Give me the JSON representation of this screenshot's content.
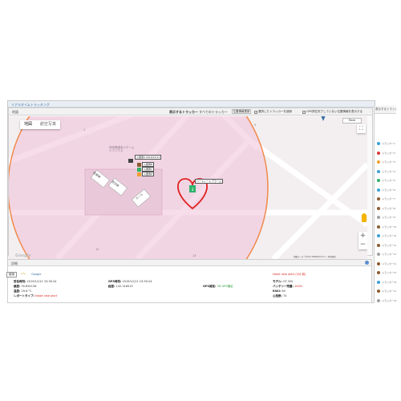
{
  "app": {
    "title": "リアルタイムトラッキング"
  },
  "map_panel": {
    "label": "地図",
    "tracker_label": "表示するトラッカー",
    "tracker_value": "すべてのトラッカー",
    "search_button": "位置情報更新",
    "check_selected": "選択したトラッカーを追跡",
    "check_gps": "GPS測位完了していない位置情報を表示する",
    "map_tabs": [
      "地図",
      "航空写真"
    ],
    "more_button": "More",
    "zoom_in": "+",
    "zoom_out": "−",
    "google": "Google",
    "footer": "地図データ ©2019 ZENRIN  20 m ─  利用規約"
  },
  "map_labels": {
    "tracker_callout": "ハートレート アラーム",
    "building_1": "特別養護老人ホーム",
    "building_2": "ケアハウス",
    "area_a": "医療棟",
    "area_b": "居住棟",
    "area_c": "ホール",
    "number_1": "1",
    "number_5": "5",
    "number_12": "12",
    "number_13": "13"
  },
  "callouts": [
    "ハートレート アラーム",
    "入居者A 2019/12/11",
    "入居者B",
    "入居者C",
    "入居者D"
  ],
  "details": {
    "header": "詳細",
    "use_button": "使用",
    "google_label": "Google",
    "alert_top": "Heart rate alert (2分 前)",
    "received_label": "受信時刻:",
    "received_value": "2019/12/11 15:30:24",
    "gps_time_label": "GPS時刻:",
    "gps_time_value": "2019/12/11 15:30:24",
    "model_label": "モデル:",
    "model_value": "GT-320",
    "lat_label": "緯度:",
    "lat_value": "35.692136",
    "lng_label": "経度:",
    "lng_value": "142.316515",
    "gps_status_label": "GPS補足:",
    "gps_status_value": "3D GPS補足",
    "battery_label": "バッテリー残量:",
    "battery_value": "100%",
    "temp_label": "温度:",
    "temp_value": "29.6 °C",
    "speed_label": "RSSI:",
    "speed_value": "60",
    "report_label": "レポートタイプ:",
    "report_value": "Heart rate alert",
    "count_label": "心拍数:",
    "count_value": "74"
  },
  "side": {
    "header": "表示するトラッカー",
    "items": [
      "トラッカー1",
      "トラッカー2",
      "トラッカー3",
      "トラッカー4",
      "トラッカー5",
      "トラッカー6",
      "トラッカー7",
      "トラッカー8",
      "トラッカー9",
      "トラッカー10",
      "トラッカー11",
      "トラッカー12",
      "トラッカー13",
      "トラッカー14",
      "トラッカー15",
      "トラッカー16",
      "トラッカー17",
      "トラッカー18"
    ],
    "colors": [
      "#3aa0d8",
      "#d93a3a",
      "#f0a030",
      "#3aa0d8",
      "#2fb36a",
      "#3aa0d8",
      "#8d5b2f",
      "#8d5b2f",
      "#a0a0a0",
      "#8d5b2f",
      "#3aa0d8",
      "#8d5b2f",
      "#a0a0a0",
      "#8d5b2f",
      "#8d5b2f",
      "#3aa0d8",
      "#8d5b2f",
      "#a0a0a0"
    ]
  },
  "colors": {
    "circle_fill": "#f3c5db",
    "circle_stroke": "#f08a4b",
    "heart": "#e02020",
    "accent": "#3a6ea5"
  }
}
